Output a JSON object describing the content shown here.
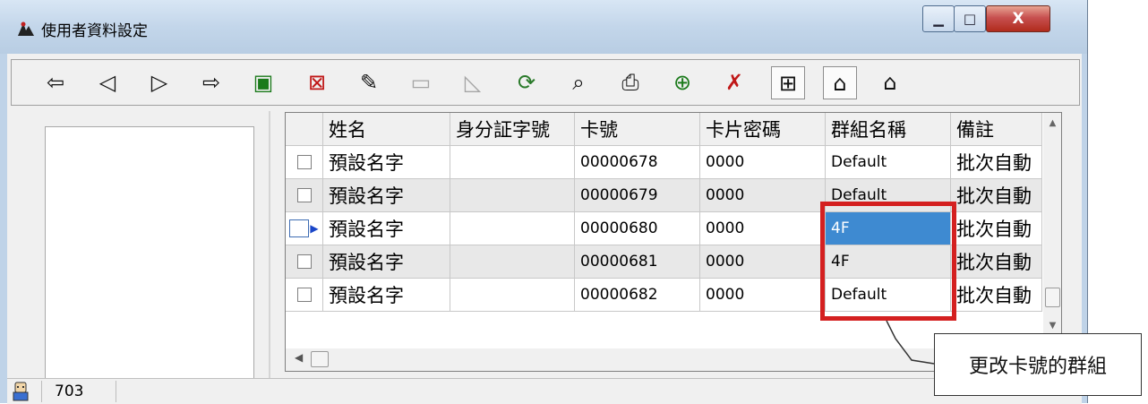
{
  "window": {
    "title": "使用者資料設定",
    "controls": {
      "minimize": "▁",
      "maximize": "□",
      "close": "X"
    }
  },
  "toolbar": {
    "buttons": [
      {
        "name": "first-record",
        "icon": "arrow-left-bold-icon",
        "glyph": "⇦"
      },
      {
        "name": "prev-record",
        "icon": "arrow-left-outline-icon",
        "glyph": "◁"
      },
      {
        "name": "next-record",
        "icon": "arrow-right-outline-icon",
        "glyph": "▷"
      },
      {
        "name": "last-record",
        "icon": "arrow-right-bold-icon",
        "glyph": "⇨"
      },
      {
        "name": "add-record",
        "icon": "add-record-icon",
        "glyph": "▣"
      },
      {
        "name": "delete-record",
        "icon": "delete-record-icon",
        "glyph": "⊠"
      },
      {
        "name": "edit-record",
        "icon": "edit-record-icon",
        "glyph": "✎"
      },
      {
        "name": "save-record",
        "icon": "save-icon",
        "glyph": "▭"
      },
      {
        "name": "cancel-edit",
        "icon": "cancel-edit-icon",
        "glyph": "◺"
      },
      {
        "name": "refresh",
        "icon": "refresh-icon",
        "glyph": "⟳"
      },
      {
        "name": "search",
        "icon": "search-icon",
        "glyph": "⌕"
      },
      {
        "name": "print",
        "icon": "print-icon",
        "glyph": "⎙"
      },
      {
        "name": "import",
        "icon": "import-icon",
        "glyph": "⊕"
      },
      {
        "name": "delete-all",
        "icon": "delete-all-icon",
        "glyph": "✗"
      },
      {
        "name": "export-card",
        "icon": "card-export-icon",
        "glyph": "⊞"
      },
      {
        "name": "upload-building",
        "icon": "building-up-icon",
        "glyph": "⌂"
      },
      {
        "name": "download-building",
        "icon": "building-down-icon",
        "glyph": "⌂"
      }
    ]
  },
  "grid": {
    "columns": [
      "姓名",
      "身分証字號",
      "卡號",
      "卡片密碼",
      "群組名稱",
      "備註"
    ],
    "rows": [
      {
        "name": "預設名字",
        "id": "",
        "card": "00000678",
        "password": "0000",
        "group": "Default",
        "note": "批次自動"
      },
      {
        "name": "預設名字",
        "id": "",
        "card": "00000679",
        "password": "0000",
        "group": "Default",
        "note": "批次自動"
      },
      {
        "name": "預設名字",
        "id": "",
        "card": "00000680",
        "password": "0000",
        "group": "4F",
        "note": "批次自動"
      },
      {
        "name": "預設名字",
        "id": "",
        "card": "00000681",
        "password": "0000",
        "group": "4F",
        "note": "批次自動"
      },
      {
        "name": "預設名字",
        "id": "",
        "card": "00000682",
        "password": "0000",
        "group": "Default",
        "note": "批次自動"
      }
    ]
  },
  "callout": {
    "text": "更改卡號的群組"
  },
  "status": {
    "count": "703"
  },
  "colors": {
    "highlight": "#d42020",
    "selection": "#3e8ad1",
    "window_frame": "#bfd3e8"
  }
}
